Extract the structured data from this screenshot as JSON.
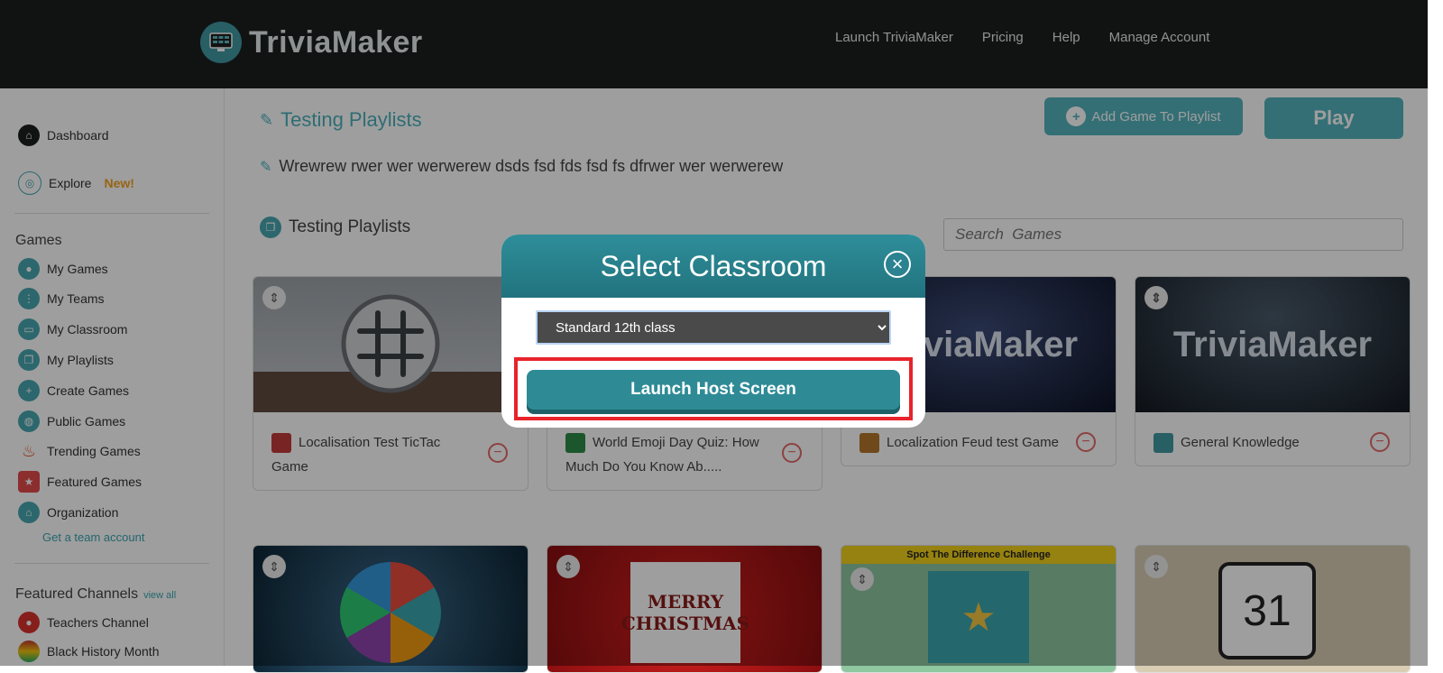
{
  "header": {
    "logo_text": "TriviaMaker",
    "nav": [
      "Launch TriviaMaker",
      "Pricing",
      "Help",
      "Manage Account"
    ]
  },
  "sidebar": {
    "dashboard": "Dashboard",
    "explore": "Explore",
    "explore_badge": "New!",
    "games_heading": "Games",
    "games": [
      "My Games",
      "My Teams",
      "My Classroom",
      "My Playlists",
      "Create Games",
      "Public Games",
      "Trending Games",
      "Featured Games",
      "Organization"
    ],
    "team_account_link": "Get a team account",
    "channels_heading": "Featured Channels",
    "view_all": "view all",
    "channels": [
      "Teachers Channel",
      "Black History Month"
    ]
  },
  "playlist": {
    "title": "Testing Playlists",
    "description": "Wrewrew rwer wer werwerew  dsds fsd fds fsd fs dfrwer wer werwerew",
    "add_game_label": "Add Game To Playlist",
    "play_label": "Play",
    "subtitle": "Testing Playlists",
    "search_placeholder": "Search  Games"
  },
  "cards": [
    {
      "title": "Localisation Test TicTac Game",
      "icon_color": "#c43a3a"
    },
    {
      "title": "World Emoji Day Quiz: How Much Do You Know Ab.....",
      "icon_color": "#2e8b4a"
    },
    {
      "title": "Localization Feud test Game",
      "icon_color": "#b4762a",
      "thumb_text": "TriviaMaker"
    },
    {
      "title": "General Knowledge",
      "icon_color": "#3f9aa3",
      "thumb_text": "TriviaMaker"
    }
  ],
  "row2_cards": [
    {
      "caption": ""
    },
    {
      "caption": "MERRY CHRISTMAS"
    },
    {
      "caption": "Spot The Difference Challenge"
    },
    {
      "caption": "31"
    }
  ],
  "modal": {
    "title": "Select Classroom",
    "close_symbol": "×",
    "selected_classroom": "Standard 12th class",
    "launch_label": "Launch Host Screen"
  },
  "colors": {
    "accent": "#3f9aa3",
    "header_bg": "#1c1f20",
    "highlight": "#e8232b"
  }
}
